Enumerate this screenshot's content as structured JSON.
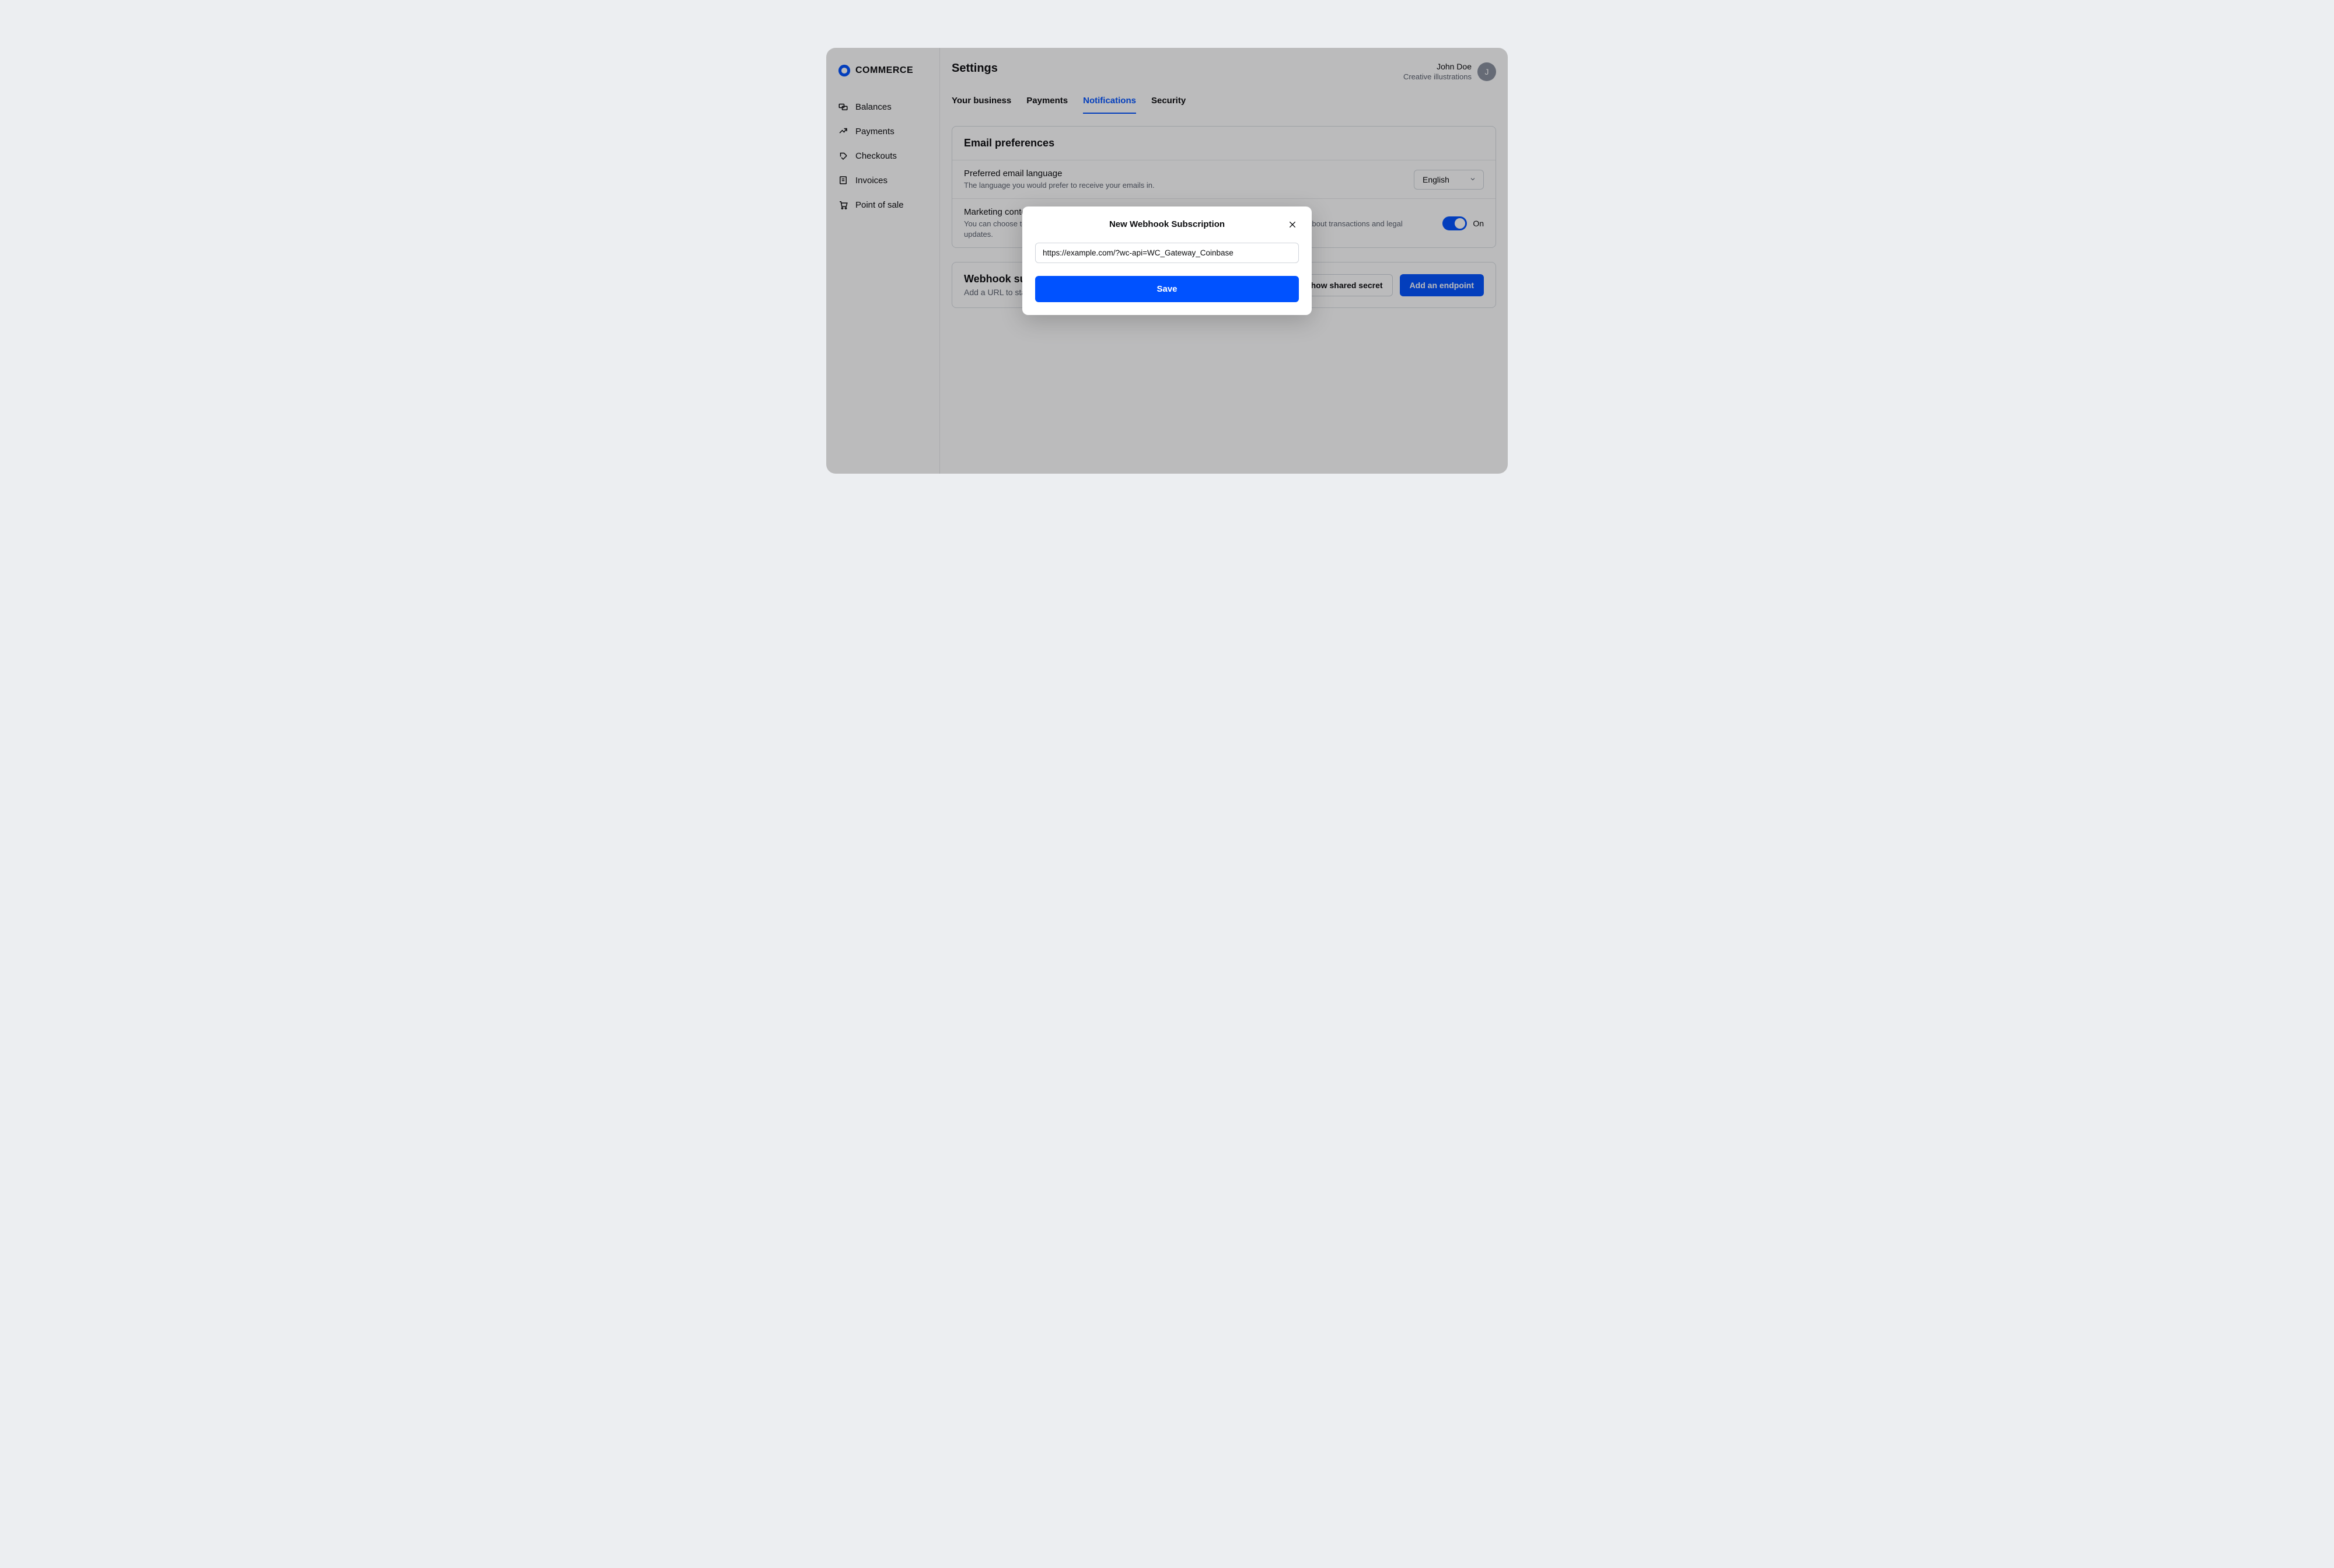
{
  "brand": {
    "name": "COMMERCE"
  },
  "sidebar": {
    "items": [
      {
        "label": "Balances"
      },
      {
        "label": "Payments"
      },
      {
        "label": "Checkouts"
      },
      {
        "label": "Invoices"
      },
      {
        "label": "Point of sale"
      }
    ]
  },
  "header": {
    "title": "Settings",
    "user_name": "John Doe",
    "user_org": "Creative illustrations",
    "avatar_initial": "J"
  },
  "tabs": [
    {
      "label": "Your business",
      "active": false
    },
    {
      "label": "Payments",
      "active": false
    },
    {
      "label": "Notifications",
      "active": true
    },
    {
      "label": "Security",
      "active": false
    }
  ],
  "email_prefs": {
    "card_title": "Email preferences",
    "lang_row": {
      "title": "Preferred email language",
      "desc": "The language you would prefer to receive your emails in.",
      "select_value": "English"
    },
    "marketing_row": {
      "title": "Marketing content",
      "desc": "You can choose to opt in to receive emails about Coinbase Commerce. You will always receive emails about transactions and legal updates.",
      "toggle_label": "On"
    }
  },
  "webhooks": {
    "title": "Webhook subscriptions",
    "desc": "Add a URL to start receiving events from Coinbase Commerce.",
    "show_secret_label": "Show shared secret",
    "add_endpoint_label": "Add an endpoint"
  },
  "modal": {
    "title": "New Webhook Subscription",
    "input_value": "https://example.com/?wc-api=WC_Gateway_Coinbase",
    "save_label": "Save"
  },
  "colors": {
    "accent": "#0052ff"
  }
}
